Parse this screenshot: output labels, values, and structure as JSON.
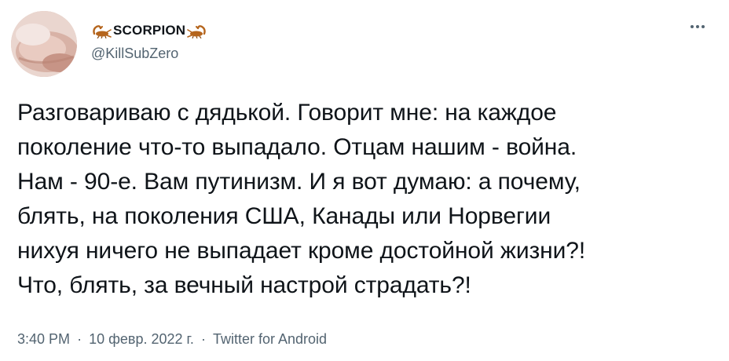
{
  "author": {
    "display_name": "SCORPION",
    "handle": "@KillSubZero",
    "avatar_icon": "avatar-photo",
    "name_icons": [
      "scorpion-icon",
      "scorpion-icon"
    ]
  },
  "tweet": {
    "text_lines": [
      "Разговариваю с дядькой. Говорит мне: на каждое",
      "поколение что-то выпадало. Отцам нашим - война.",
      "Нам - 90-е. Вам путинизм. И я вот думаю: а почему,",
      "блять, на поколения США, Канады или Норвегии",
      "нихуя ничего не выпадает кроме достойной жизни?!",
      "Что, блять, за вечный настрой страдать?!"
    ],
    "time": "3:40 PM",
    "separator": "·",
    "date": "10 февр. 2022 г.",
    "source": "Twitter for Android"
  },
  "menu": {
    "more_icon": "more-options-icon"
  },
  "colors": {
    "text": "#0f1419",
    "secondary": "#536471",
    "scorpion": "#b5651d"
  }
}
